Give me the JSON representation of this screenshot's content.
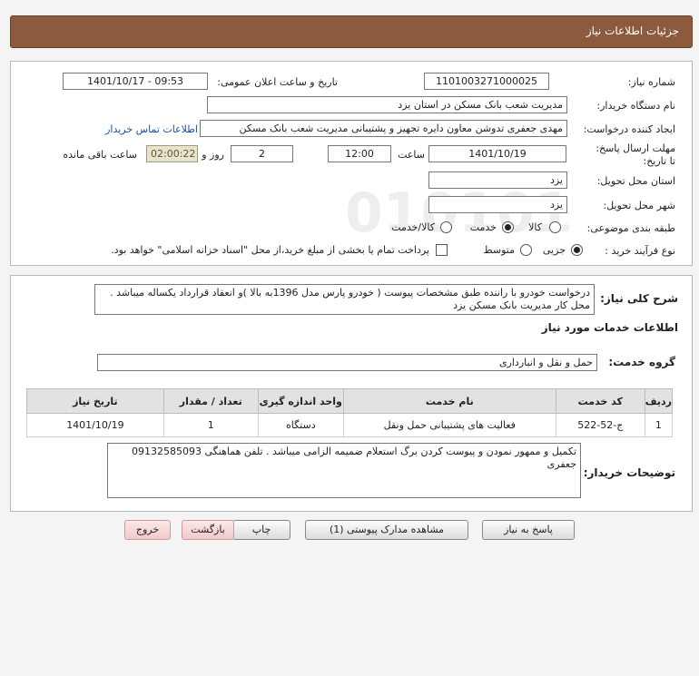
{
  "header": {
    "title": "جزئیات اطلاعات نیاز"
  },
  "info": {
    "need_number_label": "شماره نیاز:",
    "need_number": "1101003271000025",
    "announce_label": "تاریخ و ساعت اعلان عمومی:",
    "announce_value": "1401/10/17 - 09:53",
    "buyer_org_label": "نام دستگاه خریدار:",
    "buyer_org": "مدیریت شعب بانک مسکن در استان یزد",
    "creator_label": "ایجاد کننده درخواست:",
    "creator": "مهدی  جعفری تدوشن معاون دایره تجهیز و پشتیبانی مدیریت شعب بانک مسکن",
    "contact_link": "اطلاعات تماس خریدار",
    "deadline_label": "مهلت ارسال پاسخ: تا تاریخ:",
    "deadline_date": "1401/10/19",
    "time_label": "ساعت",
    "deadline_time": "12:00",
    "days_value": "2",
    "days_label": "روز و",
    "remaining_time": "02:00:22",
    "remaining_label": "ساعت باقی مانده",
    "province_label": "استان محل تحویل:",
    "province": "یزد",
    "city_label": "شهر محل تحویل:",
    "city": "یزد",
    "category_label": "طبقه بندی موضوعی:",
    "category_options": [
      "کالا",
      "خدمت",
      "کالا/خدمت"
    ],
    "category_selected": "خدمت",
    "process_label": "نوع فرآیند خرید :",
    "process_options": [
      "جزیی",
      "متوسط"
    ],
    "process_selected": "جزیی",
    "payment_note": "پرداخت تمام یا بخشی از مبلغ خرید،از محل \"اسناد خزانه اسلامی\" خواهد بود."
  },
  "description": {
    "label": "شرح کلی نیاز:",
    "text": "درخواست خودرو با راننده طبق مشخصات پیوست ( خودرو پارس مدل 1396به بالا )و انعقاد قرارداد یکساله میباشد . محل کار مدیریت بانک مسکن یزد"
  },
  "services": {
    "section_title": "اطلاعات خدمات مورد نیاز",
    "group_label": "گروه خدمت:",
    "group_value": "حمل و نقل و انبارداری",
    "columns": [
      "ردیف",
      "کد خدمت",
      "نام خدمت",
      "واحد اندازه گیری",
      "تعداد / مقدار",
      "تاریخ نیاز"
    ],
    "rows": [
      {
        "row": "1",
        "code": "ج-52-522",
        "name": "فعالیت های پشتیبانی حمل ونقل",
        "unit": "دستگاه",
        "qty": "1",
        "date": "1401/10/19"
      }
    ]
  },
  "buyer_notes": {
    "label": "توضیحات خریدار:",
    "text": "تکمیل و ممهور نمودن و پیوست کردن برگ استعلام ضمیمه الزامی میباشد . تلفن هماهنگی 09132585093 جعفری"
  },
  "buttons": {
    "reply": "پاسخ به نیاز",
    "attachments": "مشاهده مدارک پیوستی (1)",
    "print": "چاپ",
    "back": "بازگشت",
    "exit": "خروج"
  }
}
